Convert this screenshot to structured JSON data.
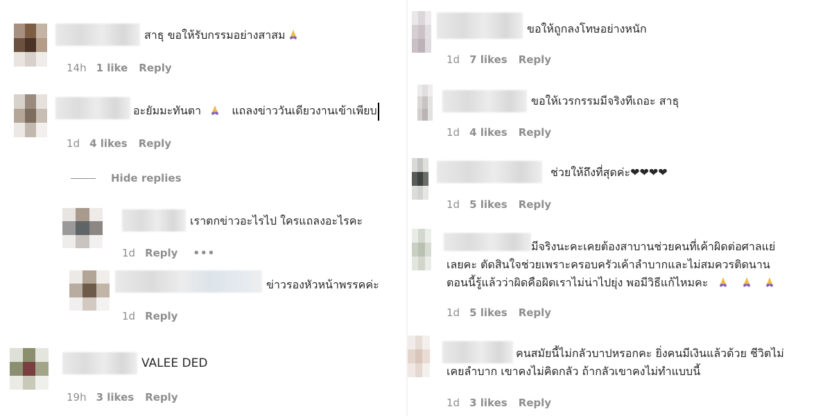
{
  "left": {
    "comments": [
      {
        "text": "สาธุ ขอให้รับกรรมอย่างสาสม",
        "emoji": "pray-icon",
        "meta": {
          "time": "14h",
          "likes": "1 like",
          "reply": "Reply"
        }
      },
      {
        "text": "อะยัมมะทันตา",
        "emoji": "pray-icon",
        "text2": "แถลงข่าววันเดียวงานเข้าเพียบ",
        "meta": {
          "time": "1d",
          "likes": "4 likes",
          "reply": "Reply"
        }
      },
      {
        "text": "เราตกข่าวอะไรไป ใครแถลงอะไรคะ",
        "meta": {
          "time": "1d",
          "reply": "Reply",
          "more": "•••"
        }
      },
      {
        "text": "ข่าวรองหัวหน้าพรรคค่ะ",
        "meta": {
          "time": "1d",
          "reply": "Reply"
        }
      },
      {
        "text": "VALEE DED",
        "meta": {
          "time": "19h",
          "likes": "3 likes",
          "reply": "Reply"
        }
      }
    ],
    "hide_replies": "Hide replies"
  },
  "right": {
    "comments": [
      {
        "text": "ขอให้ถูกลงโทษอย่างหนัก",
        "meta": {
          "time": "1d",
          "likes": "7 likes",
          "reply": "Reply"
        }
      },
      {
        "text": "ขอให้เวรกรรมมีจริงทีเถอะ สาธุ",
        "meta": {
          "time": "1d",
          "likes": "4 likes",
          "reply": "Reply"
        }
      },
      {
        "text": "ช่วยให้ถึงที่สุดค่ะ❤❤❤❤",
        "meta": {
          "time": "1d",
          "likes": "5 likes",
          "reply": "Reply"
        }
      },
      {
        "line1": "มีจริงนะคะเคยต้องสาบานช่วยคนที่เค้าผิดต่อศาลแย่",
        "line2": "เลยคะ ตัดสินใจช่วยเพราะครอบครัวเค้าลำบากและไม่สมควรติดนาน",
        "line3": "ตอนนี้รู้แล้วว่าผิดคือผิดเราไม่น่าไปยุ่ง พอมีวิธีแก้ไหมคะ",
        "meta": {
          "time": "1d",
          "likes": "5 likes",
          "reply": "Reply"
        }
      },
      {
        "line1": "คนสมัยนี้ไม่กลัวบาปหรอกคะ ยิ่งคนมีเงินแล้วด้วย ชีวิตไม่",
        "line2": "เคยลำบาก เขาคงไม่คิดกลัว ถ้ากลัวเขาคงไม่ทำแบบนี้",
        "meta": {
          "time": "1d",
          "likes": "3 likes",
          "reply": "Reply"
        }
      }
    ]
  },
  "colors": {
    "text": "#262626",
    "meta": "#8e8e8e",
    "emoji": "#7b5cc9"
  }
}
